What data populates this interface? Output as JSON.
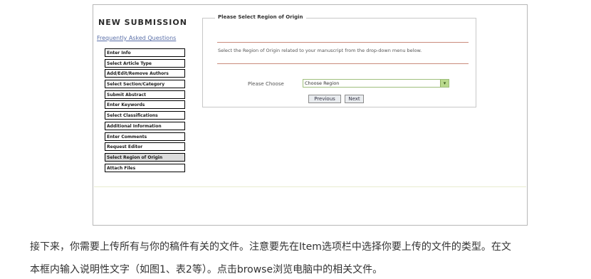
{
  "header": {
    "title": "NEW SUBMISSION",
    "faq_link": "Frequently Asked Questions"
  },
  "steps": [
    {
      "label": "Enter Info",
      "checked": true
    },
    {
      "label": "Select Article Type",
      "checked": true
    },
    {
      "label": "Add/Edit/Remove Authors",
      "checked": false
    },
    {
      "label": "Select Section/Category",
      "checked": false
    },
    {
      "label": "Submit Abstract",
      "checked": false
    },
    {
      "label": "Enter Keywords",
      "checked": true
    },
    {
      "label": "Select Classifications",
      "checked": false
    },
    {
      "label": "Additional Information",
      "checked": true
    },
    {
      "label": "Enter Comments",
      "checked": false
    },
    {
      "label": "Request Editor",
      "checked": false
    },
    {
      "label": "Select Region of Origin",
      "checked": false,
      "current": true
    },
    {
      "label": "Attach Files",
      "checked": false
    }
  ],
  "panel": {
    "legend": "Please Select Region of Origin",
    "instructions": "Select the Region of Origin related to your manuscript from the drop-down menu below.",
    "choose_label": "Please Choose",
    "select_value": "Choose Region",
    "prev_label": "Previous",
    "next_label": "Next"
  },
  "caption": {
    "line1": "接下来，你需要上传所有与你的稿件有关的文件。注意要先在Item选项栏中选择你要上传的文件的类型。在文",
    "line2": "本框内输入说明性文字（如图1、表2等）。点击browse浏览电脑中的相关文件。"
  }
}
